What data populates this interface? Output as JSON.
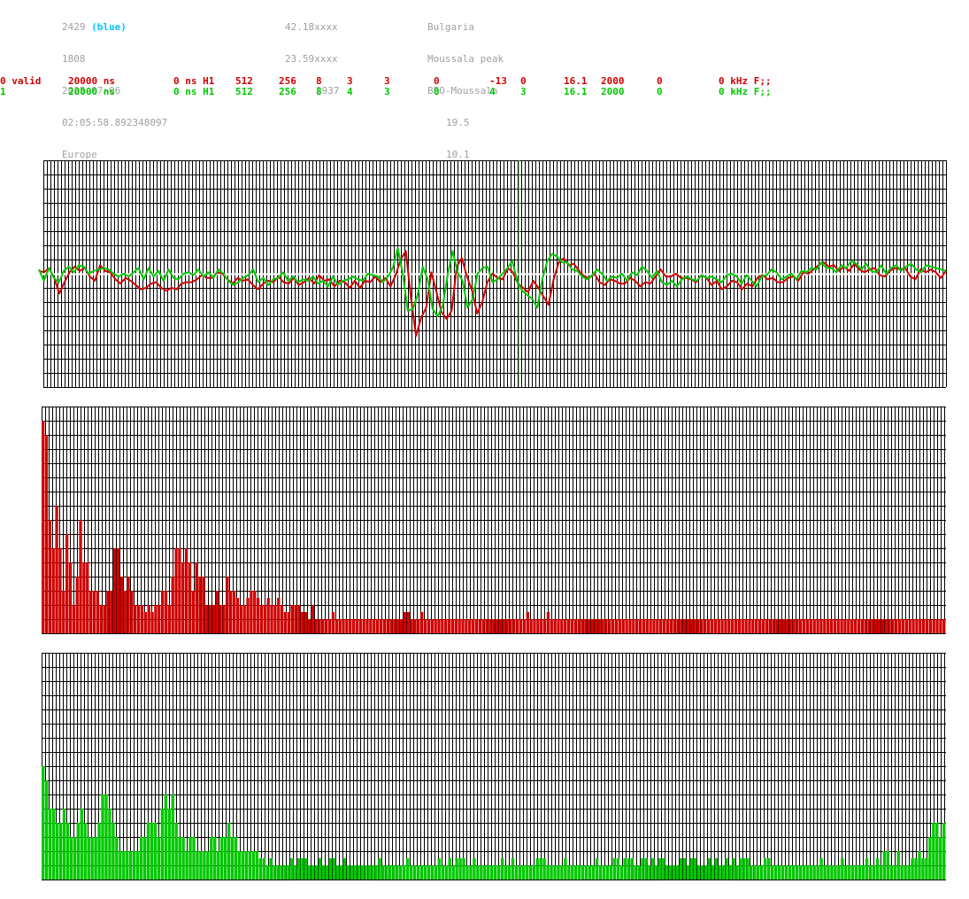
{
  "header": {
    "col1": {
      "station_number": "2429",
      "station_tag": "(blue)",
      "line2": "1808",
      "date": "2025-07-06",
      "time": "02:05:58.892348097",
      "region": "Europe"
    },
    "col2": {
      "lat": "42.18xxxx",
      "lon": "23.59xxxx",
      "alt": "2937"
    },
    "col3": {
      "country": "Bulgaria",
      "site": "Moussala peak",
      "name": "BEO-Moussala",
      "v1": "19.5",
      "v2": "10.1"
    }
  },
  "channels": [
    {
      "color": "#d00000",
      "cells": [
        "0 valid",
        "20000 ns",
        "0 ns H1",
        "512",
        "256",
        "8",
        "3",
        "3",
        "0",
        "-13",
        "0",
        "16.1",
        "2000",
        "0",
        "0 kHz F;;"
      ]
    },
    {
      "color": "#00c800",
      "cells": [
        "1",
        "20000 ns",
        "0 ns H1",
        "512",
        "256",
        "8",
        "4",
        "3",
        "0",
        "4",
        "3",
        "16.1",
        "2000",
        "0",
        "0 kHz F;;"
      ]
    }
  ],
  "chart_data": [
    {
      "type": "line",
      "ylim": [
        -8,
        8
      ],
      "x_range": [
        0,
        512
      ],
      "grid": true,
      "marker_x": 270,
      "series": [
        {
          "color": "#d00000",
          "y": [
            0.2,
            0.1,
            0.4,
            -0.3,
            -1.4,
            -0.6,
            0.1,
            0.5,
            0.2,
            0.4,
            -0.2,
            -0.5,
            0.6,
            0.2,
            0.1,
            -0.4,
            -0.7,
            -0.3,
            -0.5,
            -0.8,
            -1.1,
            -1.0,
            -0.7,
            -0.6,
            -1.0,
            -1.2,
            -1.0,
            -1.1,
            -0.7,
            -0.6,
            -0.6,
            -0.4,
            -0.1,
            -0.3,
            -0.3,
            0.1,
            0.0,
            -0.4,
            -0.7,
            -0.3,
            -0.5,
            -0.4,
            -0.8,
            -1.1,
            -0.7,
            -0.5,
            -0.6,
            -0.2,
            -0.6,
            -0.7,
            -0.3,
            -0.8,
            -0.6,
            -0.3,
            -0.7,
            -0.1,
            -0.5,
            -0.4,
            -0.9,
            -0.5,
            -0.6,
            -1.0,
            -0.5,
            -1.0,
            -0.5,
            -0.6,
            -0.2,
            -0.6,
            -0.3,
            -0.9,
            -0.1,
            1.0,
            1.6,
            -1.7,
            -4.4,
            -3.1,
            -2.4,
            0.1,
            -1.3,
            -2.7,
            -3.2,
            -2.6,
            0.5,
            1.1,
            -0.2,
            -1.2,
            -2.8,
            -2.0,
            -0.6,
            0.0,
            -0.3,
            -0.4,
            0.4,
            0.1,
            -0.7,
            -1.0,
            -1.3,
            -0.5,
            -1.0,
            -1.6,
            -2.2,
            -0.4,
            0.8,
            1.1,
            0.6,
            0.7,
            0.2,
            -0.2,
            -0.3,
            0.0,
            -0.6,
            -0.8,
            -0.4,
            -0.5,
            -0.7,
            -0.7,
            -0.3,
            -0.5,
            -0.9,
            -0.6,
            -0.7,
            -0.2,
            0.3,
            -0.2,
            -0.2,
            0.0,
            -0.3,
            -0.3,
            -0.4,
            -0.6,
            -0.1,
            -0.3,
            -0.8,
            -0.5,
            -1.1,
            -0.9,
            -0.5,
            -0.6,
            -1.1,
            -0.7,
            -0.9,
            -0.3,
            -0.1,
            -0.4,
            -0.3,
            -0.6,
            -0.6,
            -0.3,
            -0.2,
            -0.5,
            0.1,
            0.0,
            0.3,
            0.6,
            0.8,
            0.5,
            0.6,
            0.2,
            0.5,
            0.2,
            0.7,
            0.3,
            0.1,
            0.3,
            0.4,
            -0.1,
            -0.2,
            0.2,
            0.4,
            0.3,
            0.4,
            -0.2,
            -0.4,
            0.3,
            0.1,
            0.3,
            0.1,
            -0.3,
            0.2
          ]
        },
        {
          "color": "#00c800",
          "y": [
            0.3,
            -0.5,
            0.4,
            -0.3,
            -0.6,
            0.2,
            0.5,
            0.1,
            0.6,
            0.5,
            0.0,
            0.2,
            0.3,
            0.4,
            0.3,
            0.0,
            -0.2,
            0.0,
            -0.2,
            0.1,
            0.4,
            -0.4,
            0.4,
            -0.2,
            0.2,
            -0.5,
            0.3,
            -0.3,
            -0.4,
            0.0,
            0.1,
            -0.1,
            0.3,
            -0.2,
            0.1,
            -0.3,
            0.3,
            0.0,
            -0.5,
            -0.8,
            -0.6,
            -0.3,
            -0.1,
            0.3,
            -0.6,
            -0.3,
            -0.8,
            -0.4,
            -0.3,
            0.1,
            -0.5,
            -0.2,
            -0.6,
            -0.4,
            -0.5,
            -0.2,
            -0.7,
            -0.5,
            -0.9,
            -0.2,
            -0.8,
            -0.5,
            -0.4,
            -0.2,
            -0.4,
            -0.5,
            0.0,
            -0.1,
            -0.2,
            -0.6,
            -0.2,
            0.4,
            1.8,
            0.0,
            -2.6,
            -2.5,
            -1.5,
            0.5,
            -0.4,
            -2.5,
            -3.0,
            -2.3,
            -0.1,
            1.6,
            0.1,
            -0.5,
            -2.4,
            -1.8,
            0.0,
            0.4,
            0.5,
            -0.6,
            -0.4,
            0.0,
            0.4,
            0.9,
            -0.6,
            -1.2,
            -1.5,
            -1.8,
            -2.4,
            -0.4,
            0.9,
            1.4,
            1.2,
            0.8,
            0.8,
            0.3,
            0.2,
            -0.2,
            -0.4,
            -0.1,
            0.3,
            0.0,
            -0.5,
            -0.2,
            -0.3,
            0.0,
            -0.5,
            0.1,
            -0.1,
            0.5,
            0.2,
            -0.3,
            0.2,
            -0.6,
            -0.8,
            -0.5,
            -0.9,
            -0.4,
            -0.2,
            -0.4,
            -0.5,
            -0.1,
            -0.3,
            -0.2,
            -0.4,
            -0.6,
            -0.1,
            0.0,
            -0.2,
            -0.7,
            -0.1,
            -0.5,
            -0.9,
            -0.2,
            -0.1,
            0.3,
            0.1,
            -0.4,
            -0.2,
            0.0,
            -0.4,
            0.2,
            0.1,
            0.4,
            0.3,
            0.8,
            0.4,
            0.4,
            0.1,
            0.6,
            0.4,
            0.9,
            0.7,
            0.3,
            0.7,
            0.2,
            0.1,
            0.6,
            0.0,
            0.4,
            0.6,
            0.2,
            0.5,
            0.7,
            0.3,
            0.1,
            0.6,
            0.5,
            0.4,
            0.3,
            0.2
          ]
        }
      ]
    },
    {
      "type": "bar",
      "color": "#d00000",
      "ylim": [
        0,
        16
      ],
      "values": [
        15,
        14,
        8,
        6,
        9,
        6,
        3,
        7,
        5,
        2,
        4,
        8,
        5,
        5,
        3,
        3,
        3,
        2,
        2,
        3,
        3,
        6,
        6,
        4,
        3,
        4,
        3,
        2,
        2,
        2,
        1.5,
        2,
        1.5,
        2,
        2,
        3,
        3,
        2,
        4,
        6,
        6,
        5,
        6,
        5,
        3,
        5,
        4,
        4,
        2,
        2,
        2,
        3,
        2,
        2,
        4,
        3,
        3,
        2.5,
        2,
        2,
        2.5,
        3,
        3,
        2.5,
        2,
        2,
        2.5,
        2,
        2,
        2.5,
        2,
        1.5,
        1.5,
        2,
        2,
        2,
        1.5,
        1.5,
        1,
        2,
        1,
        1,
        1,
        1,
        1,
        1.5,
        1,
        1,
        1,
        1,
        1,
        1,
        1,
        1,
        1,
        1,
        1,
        1,
        1,
        1,
        1,
        1,
        1,
        1,
        1,
        1,
        1.5,
        1.5,
        1,
        1,
        1,
        1.5,
        1,
        1,
        1,
        1,
        1,
        1,
        1,
        1,
        1,
        1,
        1,
        1,
        1,
        1,
        1,
        1,
        1,
        1,
        1,
        1,
        1,
        1,
        1,
        1,
        1,
        1,
        1,
        1,
        1,
        1,
        1.5,
        1,
        1,
        1,
        1,
        1,
        1.5,
        1,
        1,
        1,
        1,
        1,
        1,
        1,
        1,
        1,
        1,
        1,
        1,
        1,
        1,
        1,
        1,
        1,
        1,
        1,
        1,
        1,
        1,
        1,
        1,
        1,
        1,
        1,
        1,
        1,
        1,
        1,
        1,
        1,
        1,
        1,
        1,
        1,
        1,
        1,
        1,
        1,
        1,
        1,
        1,
        1,
        1,
        1,
        1,
        1,
        1,
        1,
        1,
        1,
        1,
        1,
        1,
        1,
        1,
        1,
        1,
        1,
        1,
        1,
        1,
        1,
        1,
        1,
        1,
        1,
        1,
        1,
        1,
        1,
        1,
        1,
        1,
        1,
        1,
        1,
        1,
        1,
        1,
        1,
        1,
        1,
        1,
        1,
        1,
        1,
        1,
        1,
        1,
        1,
        1,
        1,
        1,
        1,
        1,
        1,
        1,
        1,
        1,
        1,
        1,
        1,
        1,
        1,
        1,
        1,
        1,
        1,
        1,
        1,
        1,
        1,
        1
      ]
    },
    {
      "type": "bar",
      "color": "#00c800",
      "ylim": [
        0,
        16
      ],
      "values": [
        8,
        7,
        5,
        5,
        4,
        4,
        5,
        4,
        3,
        3,
        4,
        5,
        4,
        3,
        3,
        3,
        4,
        6,
        6,
        5,
        4,
        3,
        2,
        2,
        2,
        2,
        2,
        2,
        3,
        3,
        4,
        4,
        4,
        3,
        5,
        6,
        5,
        6,
        4,
        3,
        3,
        2,
        3,
        3,
        2,
        2,
        2,
        2,
        3,
        3,
        2,
        3,
        3,
        4,
        3,
        3,
        2,
        2,
        2,
        2,
        2,
        2,
        1.5,
        1.5,
        1,
        1.5,
        1,
        1,
        1,
        1,
        1,
        1.5,
        1,
        1.5,
        1.5,
        1.5,
        1,
        1,
        1,
        1.5,
        1,
        1,
        1.5,
        1.5,
        1,
        1,
        1.5,
        1,
        1,
        1,
        1,
        1,
        1,
        1,
        1,
        1,
        1.5,
        1,
        1,
        1,
        1,
        1,
        1,
        1,
        1.5,
        1,
        1,
        1,
        1,
        1,
        1,
        1,
        1,
        1.5,
        1,
        1,
        1.5,
        1,
        1.5,
        1.5,
        1.5,
        1,
        1,
        1.5,
        1,
        1,
        1,
        1,
        1,
        1,
        1,
        1.5,
        1,
        1,
        1.5,
        1,
        1,
        1,
        1,
        1,
        1,
        1.5,
        1.5,
        1.5,
        1,
        1,
        1,
        1,
        1,
        1.5,
        1,
        1,
        1,
        1,
        1,
        1,
        1,
        1,
        1.5,
        1,
        1,
        1,
        1,
        1.5,
        1.5,
        1,
        1.5,
        1.5,
        1.5,
        1,
        1,
        1.5,
        1.5,
        1,
        1.5,
        1,
        1.5,
        1.5,
        1,
        1,
        1,
        1,
        1.5,
        1.5,
        1,
        1.5,
        1.5,
        1,
        1,
        1,
        1.5,
        1,
        1.5,
        1,
        1,
        1.5,
        1,
        1.5,
        1,
        1.5,
        1.5,
        1.5,
        1,
        1,
        1,
        1,
        1.5,
        1.5,
        1,
        1,
        1,
        1,
        1,
        1,
        1,
        1,
        1,
        1,
        1,
        1,
        1,
        1,
        1.5,
        1,
        1,
        1,
        1,
        1,
        1.5,
        1,
        1,
        1,
        1,
        1,
        1,
        1.5,
        1,
        1,
        1.5,
        1,
        2,
        2,
        1,
        1,
        2,
        1,
        1,
        1,
        1.5,
        1.5,
        2,
        1.5,
        1.5,
        3,
        4,
        4,
        3,
        4
      ]
    }
  ]
}
